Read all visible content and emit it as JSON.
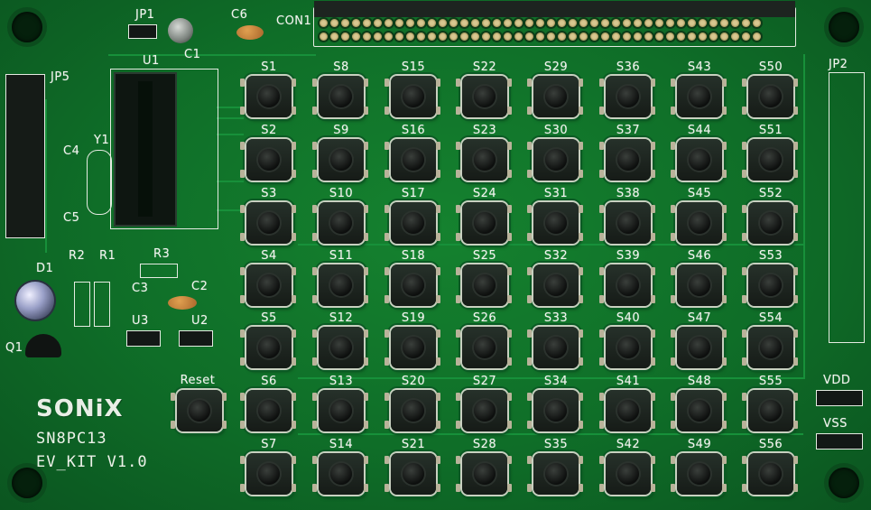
{
  "board": {
    "brand": "SONiX",
    "model": "SN8PC13",
    "version": "EV_KIT  V1.0",
    "colors": {
      "pcb": "#0f6e28",
      "silk": "#f2f4ef",
      "pad": "#d8c890"
    }
  },
  "labels": {
    "jp1": "JP1",
    "c6": "C6",
    "c1": "C1",
    "con1": "CON1",
    "jp5": "JP5",
    "u1": "U1",
    "c4": "C4",
    "y1": "Y1",
    "c5": "C5",
    "r2": "R2",
    "r1": "R1",
    "r3": "R3",
    "d1": "D1",
    "c3": "C3",
    "c2": "C2",
    "u3": "U3",
    "u2": "U2",
    "q1": "Q1",
    "jp2": "JP2",
    "vdd": "VDD",
    "vss": "VSS",
    "reset": "Reset"
  },
  "switch_columns": [
    [
      "S1",
      "S2",
      "S3",
      "S4",
      "S5",
      "S6",
      "S7"
    ],
    [
      "S8",
      "S9",
      "S10",
      "S11",
      "S12",
      "S13",
      "S14"
    ],
    [
      "S15",
      "S16",
      "S17",
      "S18",
      "S19",
      "S20",
      "S21"
    ],
    [
      "S22",
      "S23",
      "S24",
      "S25",
      "S26",
      "S27",
      "S28"
    ],
    [
      "S29",
      "S30",
      "S31",
      "S32",
      "S33",
      "S34",
      "S35"
    ],
    [
      "S36",
      "S37",
      "S38",
      "S39",
      "S40",
      "S41",
      "S42"
    ],
    [
      "S43",
      "S44",
      "S45",
      "S46",
      "S47",
      "S48",
      "S49"
    ],
    [
      "S50",
      "S51",
      "S52",
      "S53",
      "S54",
      "S55",
      "S56"
    ]
  ]
}
